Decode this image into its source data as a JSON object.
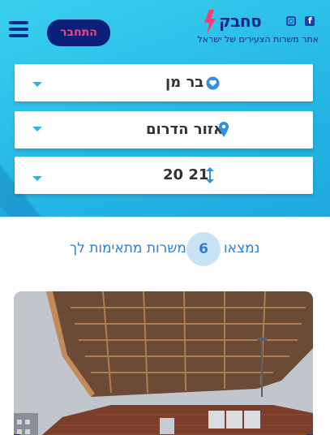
{
  "header": {
    "logo_text": "סחבק",
    "tagline": "אתר משרות הצעירים של ישראל",
    "login_label": "התחבר",
    "social": [
      "facebook-icon",
      "instagram-icon"
    ],
    "menu_icon": "hamburger-menu-icon"
  },
  "filters": [
    {
      "value": "בר מן",
      "icon": "heart-badge-icon"
    },
    {
      "value": "אזור הדרום",
      "icon": "location-pin-icon"
    },
    {
      "value": "20 21",
      "icon": "vertical-range-icon"
    }
  ],
  "results": {
    "prefix": "נמצאו",
    "count": "6",
    "suffix": "משרות מתאימות לך"
  },
  "colors": {
    "hero_bg": "#27b8e6",
    "brand_navy": "#0f2a8a",
    "login_text": "#ff3b7a",
    "accent_blue": "#2f7fd0"
  }
}
